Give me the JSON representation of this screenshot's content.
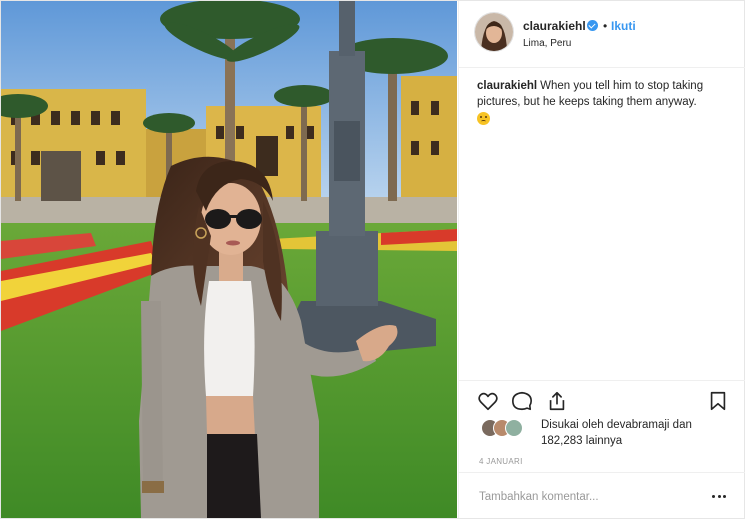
{
  "post": {
    "username": "claurakiehl",
    "follow_label": "Ikuti",
    "separator": "•",
    "location": "Lima, Peru",
    "caption": {
      "username": "claurakiehl",
      "text": "When you tell him to stop taking pictures, but he keeps taking them anyway.",
      "emoji": "grimacing-face"
    },
    "likes": {
      "prefix": "Disukai oleh devabramaji dan",
      "count_text": "182,283 lainnya"
    },
    "date": "4 JANUARI",
    "comment": {
      "placeholder": "Tambahkan komentar..."
    }
  },
  "colors": {
    "accent": "#3897f0",
    "text": "#262626",
    "muted": "#999999",
    "border": "#efefef"
  },
  "icons": {
    "like": "heart-icon",
    "comment": "comment-icon",
    "share": "share-icon",
    "save": "bookmark-icon",
    "verified": "verified-badge-icon",
    "more": "more-options-icon"
  }
}
